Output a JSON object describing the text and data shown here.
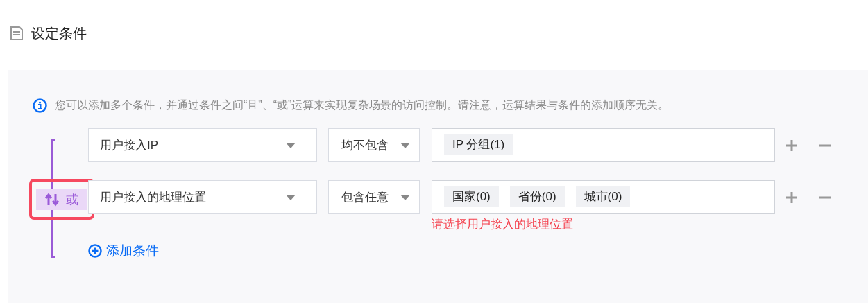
{
  "heading": "设定条件",
  "info": "您可以添加多个条件，并通过条件之间“且”、“或”运算来实现复杂场景的访问控制。请注意，运算结果与条件的添加顺序无关。",
  "logic": {
    "label": "或",
    "highlighted": true
  },
  "conditions": [
    {
      "field": "用户接入IP",
      "operator": "均不包含",
      "tags": [
        "IP 分组(1)"
      ]
    },
    {
      "field": "用户接入的地理位置",
      "operator": "包含任意",
      "tags": [
        "国家(0)",
        "省份(0)",
        "城市(0)"
      ],
      "error": "请选择用户接入的地理位置"
    }
  ],
  "add_button": "添加条件"
}
